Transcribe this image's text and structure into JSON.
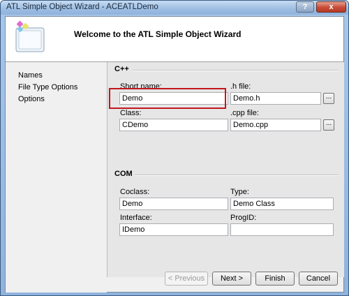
{
  "window": {
    "title": "ATL Simple Object Wizard - ACEATLDemo",
    "help": "?",
    "close": "x"
  },
  "header": {
    "welcome": "Welcome to the ATL Simple Object Wizard"
  },
  "nav": {
    "items": [
      "Names",
      "File Type Options",
      "Options"
    ]
  },
  "cpp": {
    "group": "C++",
    "short_name_label": "Short name:",
    "short_name": "Demo",
    "h_file_label": ".h file:",
    "h_file": "Demo.h",
    "class_label": "Class:",
    "class": "CDemo",
    "cpp_file_label": ".cpp file:",
    "cpp_file": "Demo.cpp",
    "browse": "..."
  },
  "com": {
    "group": "COM",
    "coclass_label": "Coclass:",
    "coclass": "Demo",
    "type_label": "Type:",
    "type": "Demo Class",
    "interface_label": "Interface:",
    "interface": "IDemo",
    "progid_label": "ProgID:",
    "progid": ""
  },
  "buttons": {
    "previous": "< Previous",
    "next": "Next >",
    "finish": "Finish",
    "cancel": "Cancel"
  },
  "colors": {
    "highlight": "#c4161c",
    "titlebar": "#9dbde2"
  }
}
